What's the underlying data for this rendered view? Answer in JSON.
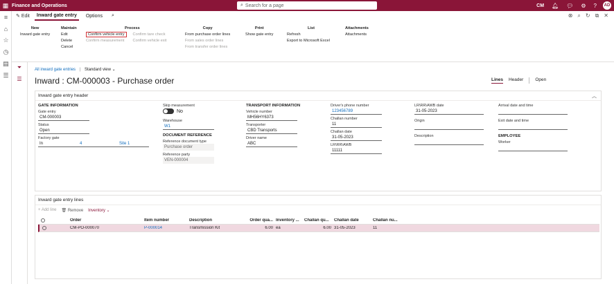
{
  "app": {
    "title": "Finance and Operations",
    "search_placeholder": "Search for a page",
    "company": "CM",
    "avatar": "AD"
  },
  "actionbar": {
    "edit_label": "Edit",
    "tabs": [
      "Inward gate entry",
      "Options"
    ]
  },
  "ribbon": {
    "new": {
      "header": "New",
      "items": [
        "Inward gate entry"
      ]
    },
    "maintain": {
      "header": "Maintain",
      "items": [
        "Edit",
        "Delete",
        "Cancel"
      ]
    },
    "process": {
      "header": "Process",
      "col1": [
        "Confirm vehicle entry",
        "Confirm measurement"
      ],
      "col2": [
        "Confirm tare check",
        "Confirm vehicle exit"
      ]
    },
    "copy": {
      "header": "Copy",
      "items": [
        "From purchase order lines",
        "From sales order lines",
        "From transfer order lines"
      ]
    },
    "print": {
      "header": "Print",
      "items": [
        "Show gate entry"
      ]
    },
    "list": {
      "header": "List",
      "items": [
        "Refresh",
        "Export to Microsoft Excel"
      ]
    },
    "attachments": {
      "header": "Attachments",
      "items": [
        "Attachments"
      ]
    }
  },
  "breadcrumb": {
    "link": "All inward gate entries",
    "view": "Standard view"
  },
  "page_title": "Inward : CM-000003 - Purchase order",
  "view_tabs": [
    "Lines",
    "Header",
    "Open"
  ],
  "header_tab": {
    "title": "Inward gate entry header",
    "gate_info": {
      "title": "GATE INFORMATION",
      "gate_entry_label": "Gate entry",
      "gate_entry": "CM-000003",
      "status_label": "Status",
      "status": "Open",
      "factory_gate_label": "Factory gate",
      "factory_gate": "In",
      "factory_gate_num": "4",
      "factory_site": "Site 1"
    },
    "col2": {
      "skip_label": "Skip measurement",
      "skip_value": "No",
      "warehouse_label": "Warehouse",
      "warehouse": "W1",
      "doc_ref_title": "DOCUMENT REFERENCE",
      "ref_doc_type_label": "Reference document type",
      "ref_doc_type": "Purchase order",
      "ref_party_label": "Reference party",
      "ref_party": "VEN-000004"
    },
    "transport": {
      "title": "TRANSPORT INFORMATION",
      "vehicle_label": "Vehicle number",
      "vehicle": "MH56HY6373",
      "transporter_label": "Transporter",
      "transporter": "CBD Transports",
      "driver_label": "Driver name",
      "driver": "ABC"
    },
    "col4": {
      "phone_label": "Driver's phone number",
      "phone": "123456789",
      "challan_no_label": "Challan number",
      "challan_no": "11",
      "challan_date_label": "Challan date",
      "challan_date": "31-05-2023",
      "lr_label": "LR\\RR\\AWB",
      "lr": "11111"
    },
    "col5": {
      "lr_date_label": "LR\\RR\\AWB date",
      "lr_date": "31-05-2023",
      "origin_label": "Origin",
      "desc_label": "Description"
    },
    "col6": {
      "arrival_label": "Arrival date and time",
      "exit_label": "Exit date and time",
      "employee_title": "EMPLOYEE",
      "worker_label": "Worker"
    }
  },
  "lines_tab": {
    "title": "Inward gate entry lines",
    "toolbar": {
      "add": "+ Add line",
      "remove": "Remove",
      "inventory": "Inventory"
    },
    "columns": [
      "Order",
      "Item number",
      "Description",
      "Order qua...",
      "Inventory ...",
      "Challan qu...",
      "Challan date",
      "Challan nu..."
    ],
    "rows": [
      {
        "order": "CM-PO-000070",
        "item": "P-000014",
        "desc": "Transmission Kit",
        "order_qty": "6.00",
        "inv_unit": "ea",
        "challan_qty": "6.00",
        "challan_date": "31-05-2023",
        "challan_no": "11"
      }
    ]
  }
}
